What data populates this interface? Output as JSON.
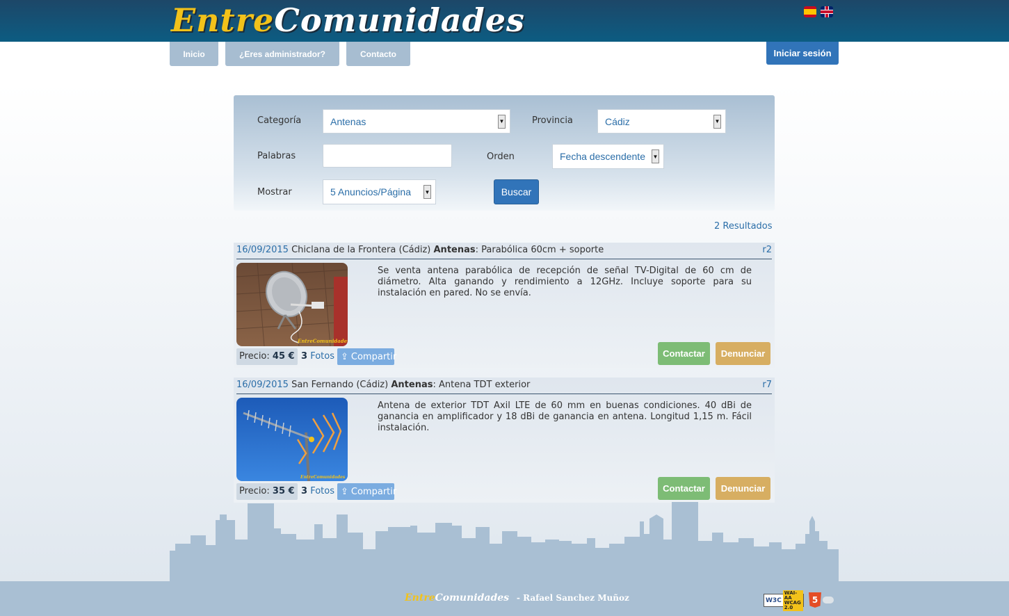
{
  "header": {
    "logo_entre": "Entre",
    "logo_comunidades": "Comunidades",
    "languages": [
      "es-flag-icon",
      "en-flag-icon"
    ]
  },
  "nav": {
    "items": [
      "Inicio",
      "¿Eres administrador?",
      "Contacto"
    ],
    "login": "Iniciar sesión"
  },
  "search": {
    "categoria_label": "Categoría",
    "categoria_value": "Antenas",
    "provincia_label": "Provincia",
    "provincia_value": "Cádiz",
    "palabras_label": "Palabras",
    "palabras_value": "",
    "orden_label": "Orden",
    "orden_value": "Fecha descendente",
    "mostrar_label": "Mostrar",
    "mostrar_value": "5 Anuncios/Página",
    "buscar": "Buscar"
  },
  "results": {
    "count_text": "2 Resultados"
  },
  "ads": [
    {
      "date": "16/09/2015",
      "location": "Chiclana de la Frontera (Cádiz)",
      "category": "Antenas",
      "title": ": Parabólica 60cm + soporte",
      "ref": "r2",
      "description": "Se venta antena parabólica de recepción de señal TV-Digital de 60 cm de diámetro. Alta ganando y rendimiento a 12GHz. Incluye soporte para su instalación en pared. No se envía.",
      "price_label": "Precio:",
      "price": "45 €",
      "photos_count": "3",
      "photos_label": "Fotos",
      "share": "Compartir",
      "contact": "Contactar",
      "report": "Denunciar",
      "watermark": "EntreComunidades"
    },
    {
      "date": "16/09/2015",
      "location": "San Fernando (Cádiz)",
      "category": "Antenas",
      "title": ": Antena TDT exterior",
      "ref": "r7",
      "description": "Antena de exterior TDT Axil LTE de 60 mm en buenas condiciones. 40 dBi de ganancia en amplificador y 18 dBi de ganancia en antena. Longitud 1,15 m. Fácil instalación.",
      "price_label": "Precio:",
      "price": "35 €",
      "photos_count": "3",
      "photos_label": "Fotos",
      "share": "Compartir",
      "contact": "Contactar",
      "report": "Denunciar",
      "watermark": "EntreComunidades"
    }
  ],
  "footer": {
    "logo_entre": "Entre",
    "logo_comunidades": "Comunidades",
    "author": "- Rafael Sanchez Muñoz",
    "wai_w3c": "W3C",
    "wai_label1": "WAI-AA",
    "wai_label2": "WCAG 2.0",
    "html5": "5"
  },
  "colors": {
    "header": "#1d4768",
    "accent": "#3174b9",
    "nav": "#a7bdd1",
    "contact": "#7dbc75",
    "report": "#d7ae62",
    "logo_yellow": "#f2c21a"
  }
}
